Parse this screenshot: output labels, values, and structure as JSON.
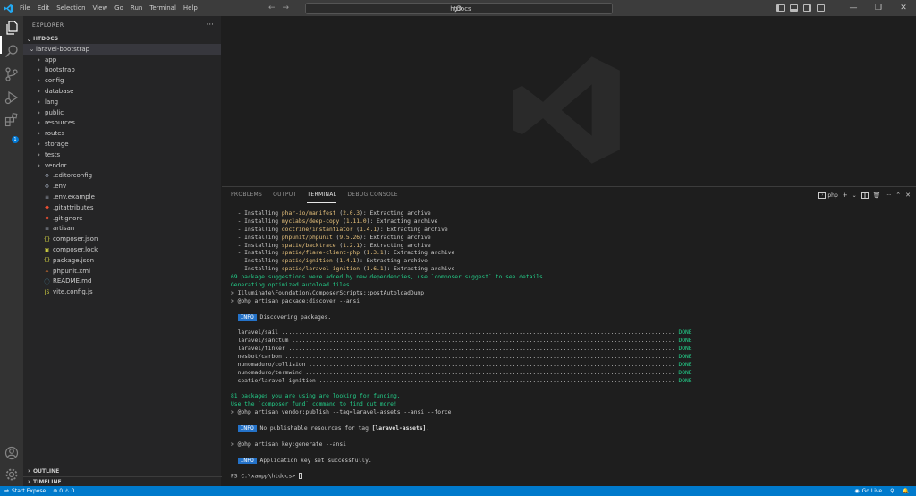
{
  "menu": [
    "File",
    "Edit",
    "Selection",
    "View",
    "Go",
    "Run",
    "Terminal",
    "Help"
  ],
  "search": {
    "text": "htdocs"
  },
  "explorer": {
    "header": "EXPLORER",
    "root": "HTDOCS",
    "project": "laravel-bootstrap",
    "folders": [
      "app",
      "bootstrap",
      "config",
      "database",
      "lang",
      "public",
      "resources",
      "routes",
      "storage",
      "tests",
      "vendor"
    ],
    "files": [
      {
        "name": ".editorconfig",
        "icon": "gear-file-icon",
        "glyph": "⚙",
        "color": "#9da5b4"
      },
      {
        "name": ".env",
        "icon": "gear-file-icon",
        "glyph": "⚙",
        "color": "#9da5b4"
      },
      {
        "name": ".env.example",
        "icon": "lines-file-icon",
        "glyph": "≡",
        "color": "#9da5b4"
      },
      {
        "name": ".gitattributes",
        "icon": "git-file-icon",
        "glyph": "◆",
        "color": "#f05033"
      },
      {
        "name": ".gitignore",
        "icon": "git-file-icon",
        "glyph": "◆",
        "color": "#f05033"
      },
      {
        "name": "artisan",
        "icon": "lines-file-icon",
        "glyph": "≡",
        "color": "#9da5b4"
      },
      {
        "name": "composer.json",
        "icon": "json-file-icon",
        "glyph": "{}",
        "color": "#cbcb41"
      },
      {
        "name": "composer.lock",
        "icon": "lock-file-icon",
        "glyph": "▣",
        "color": "#cbcb41"
      },
      {
        "name": "package.json",
        "icon": "json-file-icon",
        "glyph": "{}",
        "color": "#cbcb41"
      },
      {
        "name": "phpunit.xml",
        "icon": "xml-file-icon",
        "glyph": "⅄",
        "color": "#e37933"
      },
      {
        "name": "README.md",
        "icon": "info-file-icon",
        "glyph": "ⓘ",
        "color": "#519aba"
      },
      {
        "name": "vite.config.js",
        "icon": "js-file-icon",
        "glyph": "JS",
        "color": "#cbcb41"
      }
    ],
    "outline": "OUTLINE",
    "timeline": "TIMELINE"
  },
  "panel": {
    "tabs": [
      "PROBLEMS",
      "OUTPUT",
      "TERMINAL",
      "DEBUG CONSOLE"
    ],
    "active_tab": "TERMINAL",
    "shell": "php"
  },
  "terminal": {
    "installs": [
      {
        "pkg": "phar-io/manifest",
        "ver": "2.0.3"
      },
      {
        "pkg": "myclabs/deep-copy",
        "ver": "1.11.0"
      },
      {
        "pkg": "doctrine/instantiator",
        "ver": "1.4.1"
      },
      {
        "pkg": "phpunit/phpunit",
        "ver": "9.5.26"
      },
      {
        "pkg": "spatie/backtrace",
        "ver": "1.2.1"
      },
      {
        "pkg": "spatie/flare-client-php",
        "ver": "1.3.1"
      },
      {
        "pkg": "spatie/ignition",
        "ver": "1.4.1"
      },
      {
        "pkg": "spatie/laravel-ignition",
        "ver": "1.6.1"
      }
    ],
    "install_prefix": "  - Installing ",
    "install_suffix": ": Extracting archive",
    "suggest": "69 package suggestions were added by new dependencies, use `composer suggest` to see details.",
    "autoload": "Generating optimized autoload files",
    "post_autoload": "> Illuminate\\Foundation\\ComposerScripts::postAutoloadDump",
    "discover_cmd": "> @php artisan package:discover --ansi",
    "info_label": "INFO",
    "discovering": "Discovering packages.",
    "discovered": [
      "laravel/sail",
      "laravel/sanctum",
      "laravel/tinker",
      "nesbot/carbon",
      "nunomaduro/collision",
      "nunomaduro/termwind",
      "spatie/laravel-ignition"
    ],
    "done_label": "DONE",
    "funding1": "81 packages you are using are looking for funding.",
    "funding2": "Use the `composer fund` command to find out more!",
    "publish_cmd": "> @php artisan vendor:publish --tag=laravel-assets --ansi --force",
    "no_publish": "No publishable resources for tag ",
    "tag": "[laravel-assets]",
    "keygen_cmd": "> @php artisan key:generate --ansi",
    "key_set": "Application key set successfully.",
    "prompt": "PS C:\\xampp\\htdocs> "
  },
  "status": {
    "start_expose": "Start Expose",
    "errors": "0",
    "warnings": "0",
    "go_live": "Go Live"
  }
}
